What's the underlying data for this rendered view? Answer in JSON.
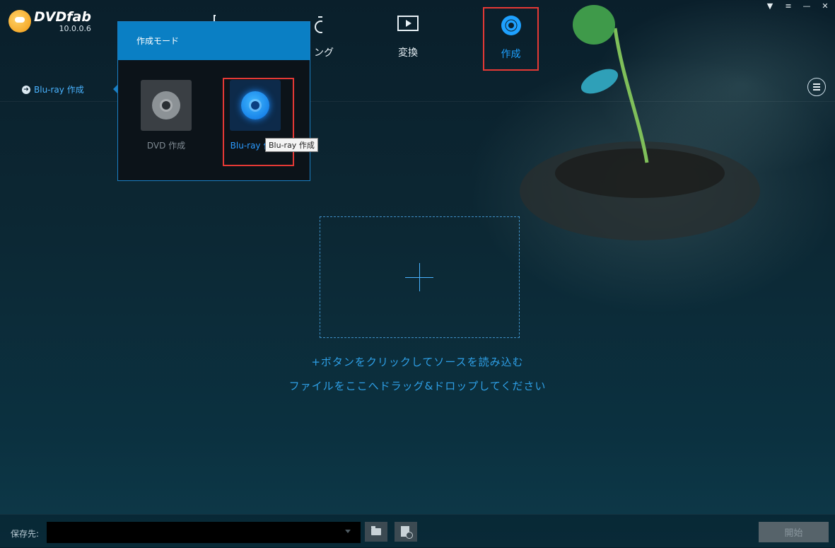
{
  "app": {
    "brand": "DVDfab",
    "version": "10.0.0.6"
  },
  "nav": {
    "items": [
      {
        "label": "ング",
        "icon": "ripper-icon"
      },
      {
        "label": "変換",
        "icon": "video-icon"
      },
      {
        "label": "作成",
        "icon": "disc-create-icon",
        "active": true
      }
    ]
  },
  "window_controls": [
    "shirt-icon",
    "dropdown-icon",
    "minimize-icon",
    "close-icon"
  ],
  "sidebar": {
    "current_mode": "Blu-ray 作成"
  },
  "popup": {
    "title": "作成モード",
    "modes": [
      {
        "label": "DVD 作成",
        "icon": "dvd-disc-icon"
      },
      {
        "label": "Blu-ray 作成",
        "icon": "bluray-disc-icon",
        "selected": true
      }
    ],
    "tooltip": "Blu-ray 作成"
  },
  "drop_zone": {
    "line1": "+ボタンをクリックしてソースを読み込む",
    "line2": "ファイルをここへドラッグ&ドロップしてください"
  },
  "bottom": {
    "save_label": "保存先:",
    "save_value": "",
    "start_label": "開始"
  },
  "colors": {
    "accent": "#1ea1ff",
    "highlight": "#e53935",
    "popup_header": "#0a7fc4"
  }
}
